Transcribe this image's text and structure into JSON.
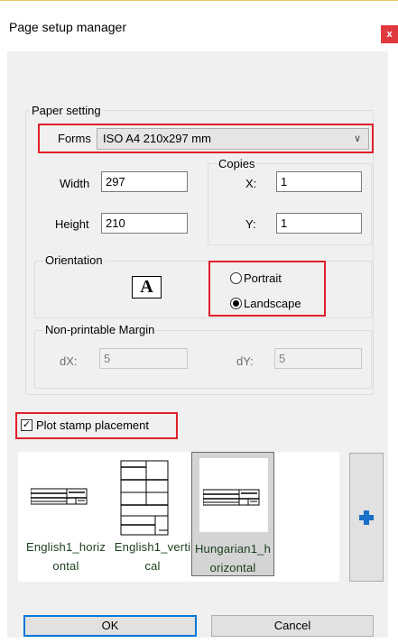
{
  "dialog": {
    "title": "Page setup manager",
    "close_label": "x"
  },
  "paper_setting": {
    "legend": "Paper setting",
    "forms_label": "Forms",
    "forms_value": "ISO A4 210x297 mm",
    "width_label": "Width",
    "width_value": "297",
    "height_label": "Height",
    "height_value": "210"
  },
  "copies": {
    "legend": "Copies",
    "x_label": "X:",
    "x_value": "1",
    "y_label": "Y:",
    "y_value": "1"
  },
  "orientation": {
    "legend": "Orientation",
    "icon_glyph": "A",
    "portrait_label": "Portrait",
    "landscape_label": "Landscape",
    "selected": "Landscape"
  },
  "margin": {
    "legend": "Non-printable Margin",
    "dx_label": "dX:",
    "dx_value": "5",
    "dy_label": "dY:",
    "dy_value": "5"
  },
  "plot_stamp": {
    "label": "Plot stamp placement",
    "checked": true
  },
  "stamps": [
    {
      "caption": "English1_horizontal",
      "selected": false
    },
    {
      "caption": "English1_vertical",
      "selected": false
    },
    {
      "caption": "Hungarian1_horizontal",
      "selected": true
    }
  ],
  "buttons": {
    "ok": "OK",
    "cancel": "Cancel"
  },
  "colors": {
    "highlight_red": "#e0202a",
    "accent_blue": "#0078d7",
    "plus_blue": "#1a6fc9"
  }
}
